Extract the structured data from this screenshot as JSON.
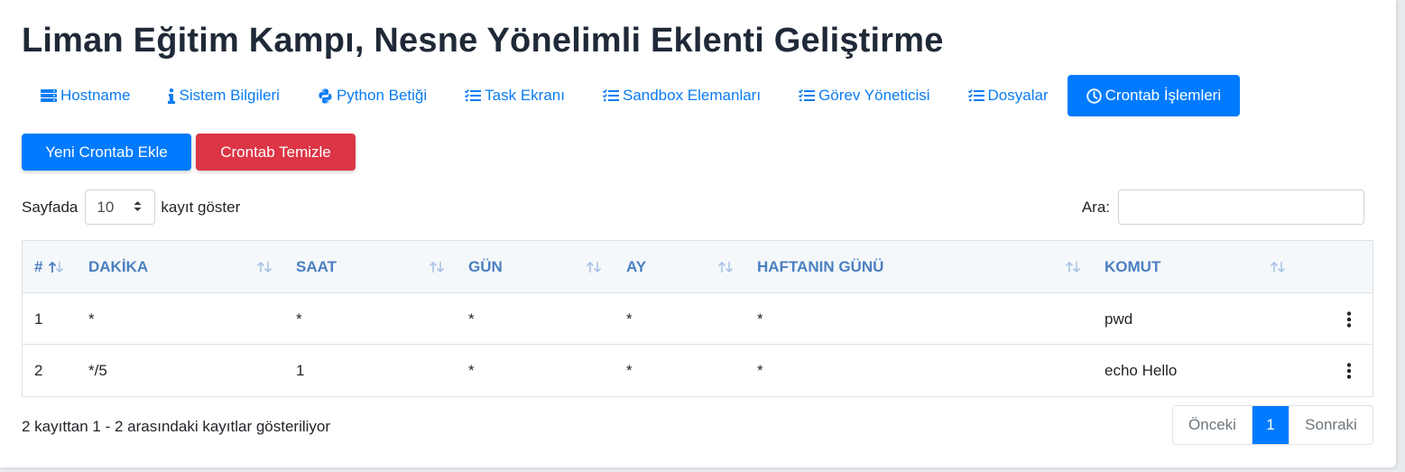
{
  "page": {
    "title": "Liman Eğitim Kampı, Nesne Yönelimli Eklenti Geliştirme"
  },
  "tabs": [
    {
      "label": "Hostname",
      "icon": "server-icon",
      "active": false
    },
    {
      "label": "Sistem Bilgileri",
      "icon": "info-icon",
      "active": false
    },
    {
      "label": "Python Betiği",
      "icon": "python-icon",
      "active": false
    },
    {
      "label": "Task Ekranı",
      "icon": "tasks-icon",
      "active": false
    },
    {
      "label": "Sandbox Elemanları",
      "icon": "tasks-icon",
      "active": false
    },
    {
      "label": "Görev Yöneticisi",
      "icon": "tasks-icon",
      "active": false
    },
    {
      "label": "Dosyalar",
      "icon": "tasks-icon",
      "active": false
    },
    {
      "label": "Crontab İşlemleri",
      "icon": "clock-icon",
      "active": true
    }
  ],
  "actions": {
    "add_label": "Yeni Crontab Ekle",
    "clear_label": "Crontab Temizle"
  },
  "length": {
    "prefix": "Sayfada",
    "value": "10",
    "suffix": "kayıt göster"
  },
  "search": {
    "label": "Ara:",
    "value": ""
  },
  "table": {
    "columns": [
      "#",
      "DAKİKA",
      "SAAT",
      "GÜN",
      "AY",
      "HAFTANIN GÜNÜ",
      "KOMUT"
    ],
    "rows": [
      [
        "1",
        "*",
        "*",
        "*",
        "*",
        "*",
        "pwd"
      ],
      [
        "2",
        "*/5",
        "1",
        "*",
        "*",
        "*",
        "echo Hello"
      ]
    ]
  },
  "info": "2 kayıttan 1 - 2 arasındaki kayıtlar gösteriliyor",
  "pagination": {
    "prev": "Önceki",
    "current": "1",
    "next": "Sonraki"
  },
  "colors": {
    "primary": "#007bff",
    "danger": "#dc3545",
    "link": "#0a7cf2",
    "header_text": "#4a7fc1",
    "sort_icon": "#aac4e6"
  }
}
